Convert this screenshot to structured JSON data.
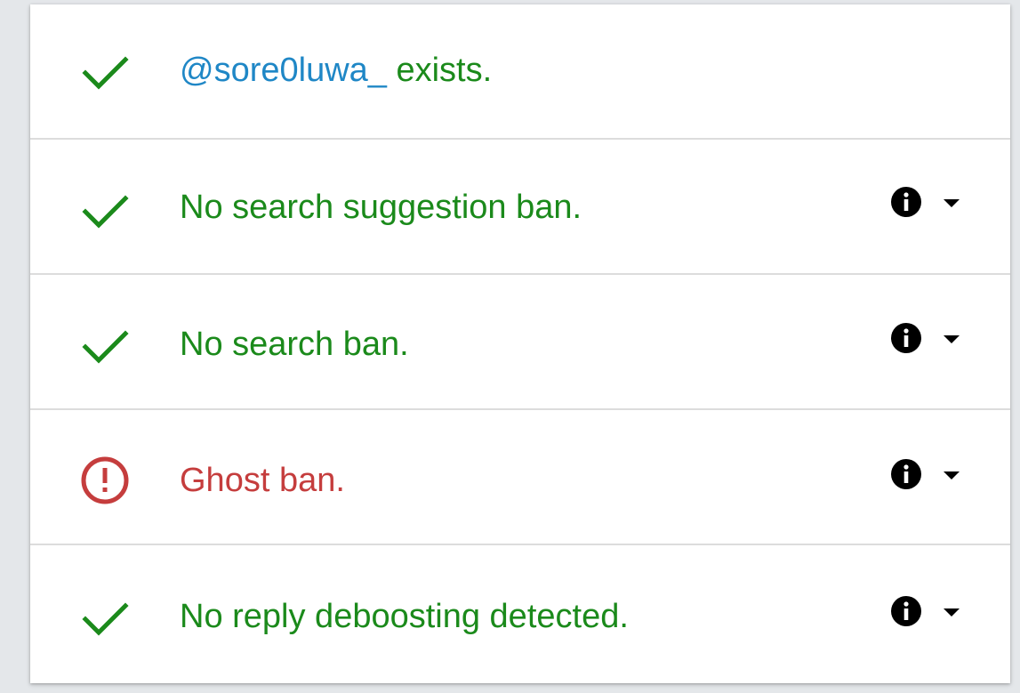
{
  "colors": {
    "ok": "#1b8a1b",
    "ban": "#c53d3d",
    "handle": "#1f87c6",
    "icon": "#000000"
  },
  "checks": [
    {
      "status": "ok",
      "icon": "check-icon",
      "handle": "@sore0luwa_",
      "text": " exists.",
      "has_details": false
    },
    {
      "status": "ok",
      "icon": "check-icon",
      "text": "No search suggestion ban.",
      "has_details": true
    },
    {
      "status": "ok",
      "icon": "check-icon",
      "text": "No search ban.",
      "has_details": true
    },
    {
      "status": "ban",
      "icon": "exclamation-circle-icon",
      "text": "Ghost ban.",
      "has_details": true
    },
    {
      "status": "ok",
      "icon": "check-icon",
      "text": "No reply deboosting detected.",
      "has_details": true
    }
  ]
}
